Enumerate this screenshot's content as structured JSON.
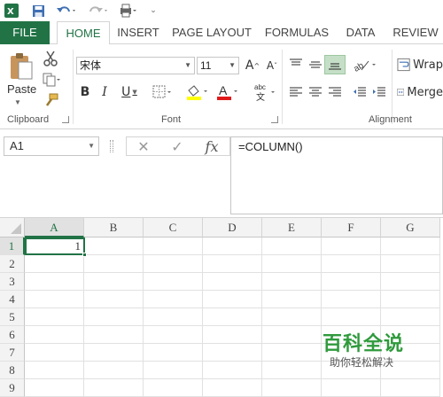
{
  "tabs": {
    "file": "FILE",
    "home": "HOME",
    "insert": "INSERT",
    "page_layout": "PAGE LAYOUT",
    "formulas": "FORMULAS",
    "data": "DATA",
    "review": "REVIEW"
  },
  "ribbon": {
    "paste_label": "Paste",
    "clipboard_group": "Clipboard",
    "font_group": "Font",
    "alignment_group": "Alignment",
    "font_name": "宋体",
    "font_size": "11",
    "wrap_label": "Wrap",
    "merge_label": "Merge"
  },
  "formula_bar": {
    "name_box": "A1",
    "formula": "=COLUMN()"
  },
  "grid": {
    "columns": [
      "A",
      "B",
      "C",
      "D",
      "E",
      "F",
      "G"
    ],
    "rows": [
      "1",
      "2",
      "3",
      "4",
      "5",
      "6",
      "7",
      "8",
      "9"
    ],
    "a1_value": "1"
  },
  "watermark": {
    "title": "百科全说",
    "subtitle": "助你轻松解决"
  },
  "colors": {
    "accent": "#217346",
    "watermark": "#2f9a3c"
  }
}
